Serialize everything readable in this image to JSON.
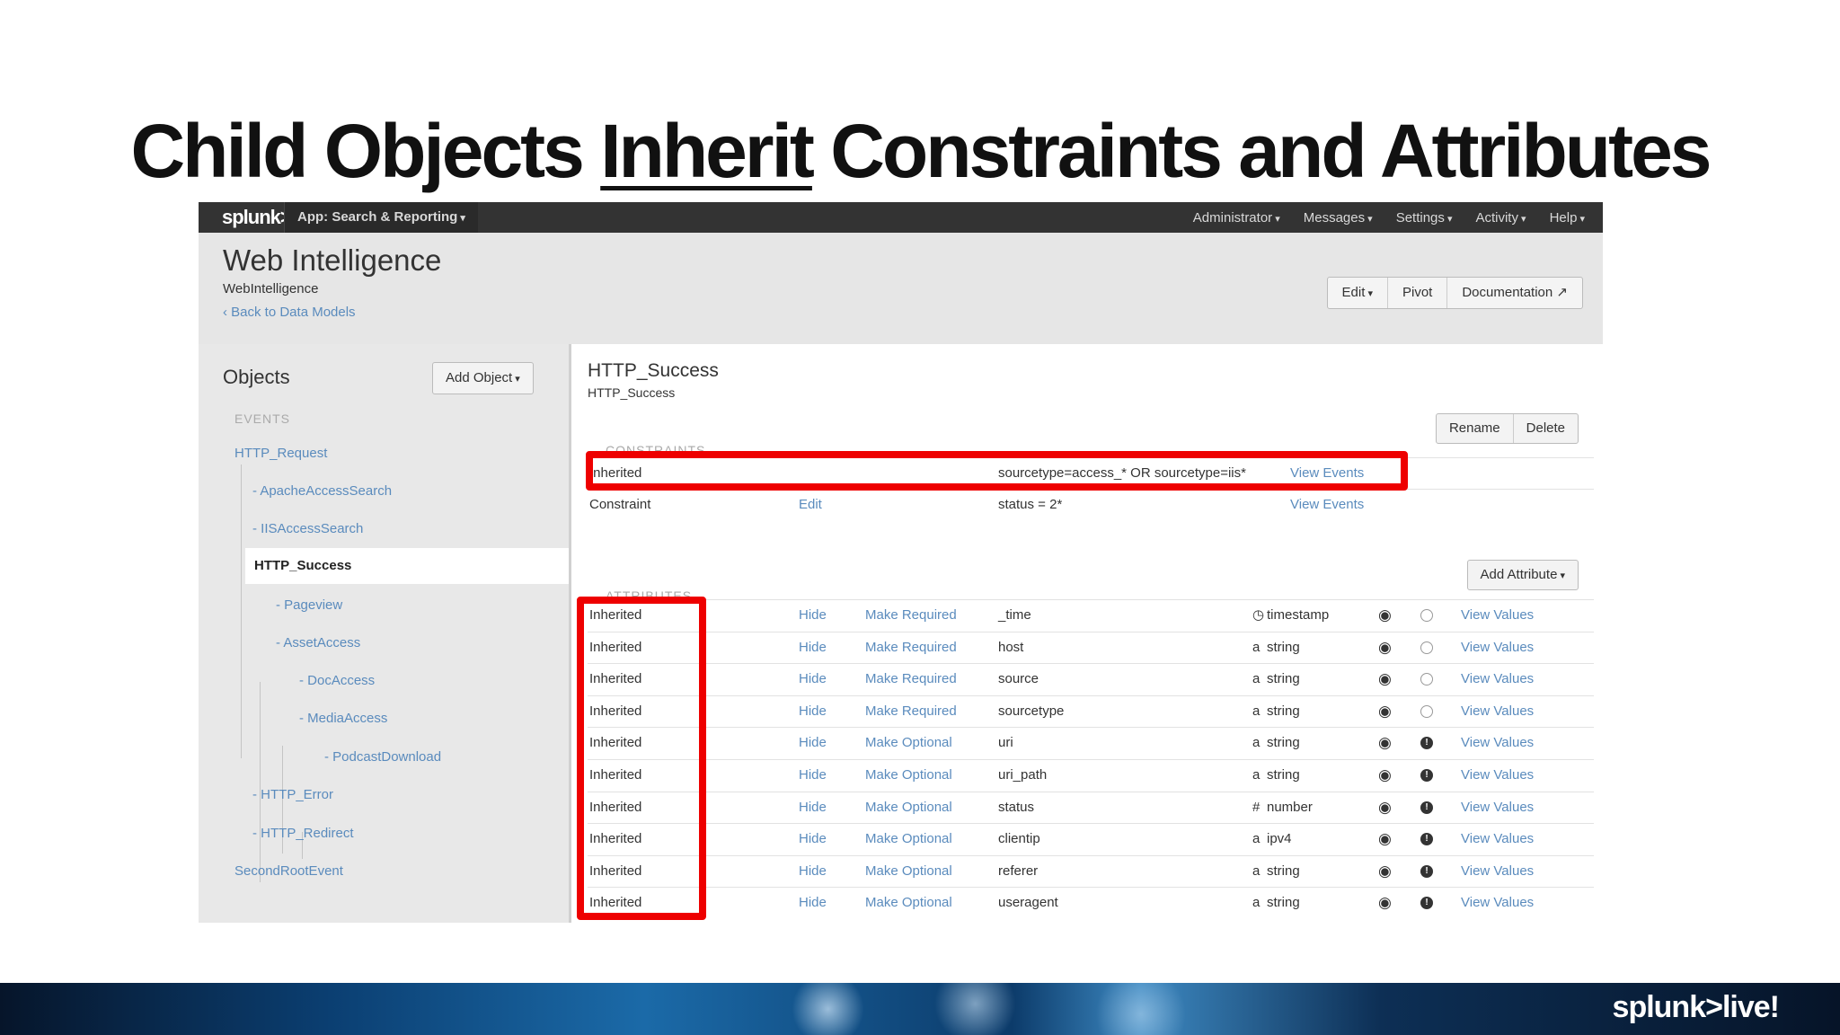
{
  "slide": {
    "title_parts": [
      "Child Objects ",
      "Inherit",
      " Constraints and Attributes"
    ],
    "footer_logo": "splunk>live!"
  },
  "topbar": {
    "logo": "splunk>",
    "app": "App: Search & Reporting",
    "nav": [
      "Administrator",
      "Messages",
      "Settings",
      "Activity",
      "Help"
    ]
  },
  "header": {
    "title": "Web Intelligence",
    "id": "WebIntelligence",
    "back_link": "‹ Back to Data Models",
    "buttons": [
      "Edit",
      "Pivot",
      "Documentation"
    ]
  },
  "sidebar": {
    "title": "Objects",
    "add_button": "Add Object",
    "events_header": "EVENTS",
    "tree": [
      {
        "label": "HTTP_Request"
      },
      {
        "label": "- ApacheAccessSearch"
      },
      {
        "label": "- IISAccessSearch"
      },
      {
        "label": "HTTP_Success"
      },
      {
        "label": "- Pageview"
      },
      {
        "label": "- AssetAccess"
      },
      {
        "label": "- DocAccess"
      },
      {
        "label": "- MediaAccess"
      },
      {
        "label": "- PodcastDownload"
      },
      {
        "label": "- HTTP_Error"
      },
      {
        "label": "- HTTP_Redirect"
      },
      {
        "label": "SecondRootEvent"
      }
    ]
  },
  "main": {
    "title": "HTTP_Success",
    "subtitle": "HTTP_Success",
    "buttons": [
      "Rename",
      "Delete"
    ],
    "constraints_header": "CONSTRAINTS",
    "constraints": [
      {
        "type": "Inherited",
        "edit": "",
        "expr": "sourcetype=access_* OR sourcetype=iis*",
        "view": "View Events"
      },
      {
        "type": "Constraint",
        "edit": "Edit",
        "expr": "status = 2*",
        "view": "View Events"
      }
    ],
    "add_attribute": "Add Attribute",
    "attributes_header": "ATTRIBUTES",
    "attributes": [
      {
        "type": "Inherited",
        "hide": "Hide",
        "req": "Make Required",
        "name": "_time",
        "ticon": "◷",
        "dtype": "timestamp",
        "required": false,
        "view": "View Values"
      },
      {
        "type": "Inherited",
        "hide": "Hide",
        "req": "Make Required",
        "name": "host",
        "ticon": "a",
        "dtype": "string",
        "required": false,
        "view": "View Values"
      },
      {
        "type": "Inherited",
        "hide": "Hide",
        "req": "Make Required",
        "name": "source",
        "ticon": "a",
        "dtype": "string",
        "required": false,
        "view": "View Values"
      },
      {
        "type": "Inherited",
        "hide": "Hide",
        "req": "Make Required",
        "name": "sourcetype",
        "ticon": "a",
        "dtype": "string",
        "required": false,
        "view": "View Values"
      },
      {
        "type": "Inherited",
        "hide": "Hide",
        "req": "Make Optional",
        "name": "uri",
        "ticon": "a",
        "dtype": "string",
        "required": true,
        "view": "View Values"
      },
      {
        "type": "Inherited",
        "hide": "Hide",
        "req": "Make Optional",
        "name": "uri_path",
        "ticon": "a",
        "dtype": "string",
        "required": true,
        "view": "View Values"
      },
      {
        "type": "Inherited",
        "hide": "Hide",
        "req": "Make Optional",
        "name": "status",
        "ticon": "#",
        "dtype": "number",
        "required": true,
        "view": "View Values"
      },
      {
        "type": "Inherited",
        "hide": "Hide",
        "req": "Make Optional",
        "name": "clientip",
        "ticon": "a",
        "dtype": "ipv4",
        "required": true,
        "view": "View Values"
      },
      {
        "type": "Inherited",
        "hide": "Hide",
        "req": "Make Optional",
        "name": "referer",
        "ticon": "a",
        "dtype": "string",
        "required": true,
        "view": "View Values"
      },
      {
        "type": "Inherited",
        "hide": "Hide",
        "req": "Make Optional",
        "name": "useragent",
        "ticon": "a",
        "dtype": "string",
        "required": true,
        "view": "View Values"
      }
    ],
    "visibility_icon": "eye-icon"
  },
  "colors": {
    "highlight": "#ee0000",
    "link": "#5a8bbd",
    "topbar": "#333333"
  }
}
